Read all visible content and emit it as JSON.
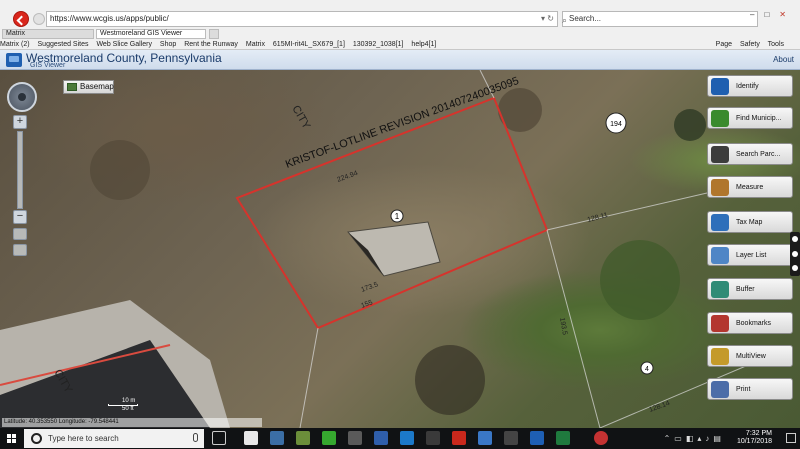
{
  "browser": {
    "address": "https://www.wcgis.us/apps/public/",
    "search_placeholder": "Search...",
    "tabs": [
      {
        "label": "Matrix"
      },
      {
        "label": "Westmoreland GIS Viewer"
      },
      {
        "label": ""
      }
    ],
    "favorites": [
      "Matrix (2)",
      "Suggested Sites",
      "Web Slice Gallery",
      "Shop",
      "Rent the Runway",
      "Matrix",
      "615MI-rit4L_SX679_[1]",
      "130392_1038[1]",
      "help4[1]"
    ],
    "menu_right": [
      "Page",
      "Safety",
      "Tools"
    ]
  },
  "app": {
    "title": "Westmoreland County, Pennsylvania",
    "subtitle": "GIS Viewer",
    "about": "About"
  },
  "map": {
    "basemap_label": "Basemap",
    "subdivision_text": "KRISTOF-LOTLINE REVISION 201407240035095",
    "parcel_label_1": "1",
    "parcel_label_194": "194",
    "parcel_label_4": "4",
    "dim_top": "224.94",
    "dim_bottom_a": "173.5",
    "dim_bottom_b": "155",
    "dim_right_a": "128.11",
    "dim_right_b": "128.14",
    "dim_right_c": "193.5",
    "city_label": "CITY",
    "scale_top": "10 m",
    "scale_bottom": "50 ft",
    "coords": "Latitude: 40.353550   Longitude: -79.548441"
  },
  "toolbar": [
    {
      "label": "Identify",
      "icon": "info-icon",
      "color": "#1f5fb0"
    },
    {
      "label": "Find Municip...",
      "icon": "find-municipality-icon",
      "color": "#3a8a2e"
    },
    {
      "label": "Search Parc...",
      "icon": "search-parcel-icon",
      "color": "#3c3c3c"
    },
    {
      "label": "Measure",
      "icon": "measure-icon",
      "color": "#b0762c"
    },
    {
      "label": "Tax Map",
      "icon": "tax-map-icon",
      "color": "#2e6fba"
    },
    {
      "label": "Layer List",
      "icon": "layer-list-icon",
      "color": "#4f86c6"
    },
    {
      "label": "Buffer",
      "icon": "buffer-icon",
      "color": "#2f8b76"
    },
    {
      "label": "Bookmarks",
      "icon": "bookmarks-icon",
      "color": "#b3362f"
    },
    {
      "label": "MultiView",
      "icon": "multiview-icon",
      "color": "#c49a2a"
    },
    {
      "label": "Print",
      "icon": "print-icon",
      "color": "#4c6da8"
    }
  ],
  "taskbar": {
    "search_placeholder": "Type here to search",
    "time": "7:32 PM",
    "date": "10/17/2018"
  }
}
